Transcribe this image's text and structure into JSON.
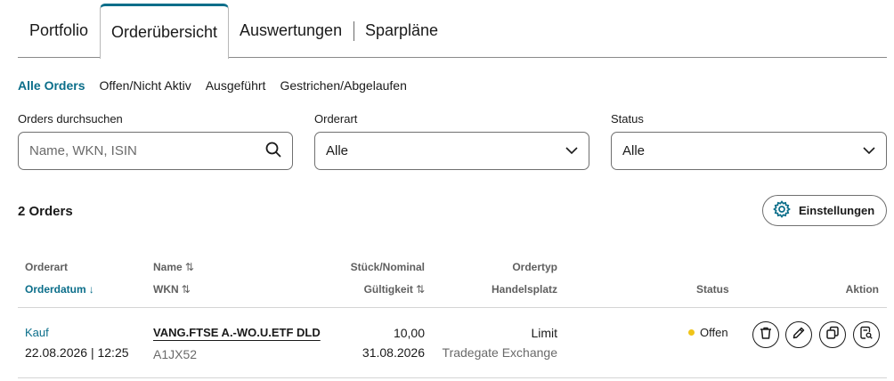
{
  "tabs": [
    {
      "label": "Portfolio"
    },
    {
      "label": "Orderübersicht"
    },
    {
      "label": "Auswertungen"
    },
    {
      "label": "Sparpläne"
    }
  ],
  "subfilters": [
    {
      "label": "Alle Orders"
    },
    {
      "label": "Offen/Nicht Aktiv"
    },
    {
      "label": "Ausgeführt"
    },
    {
      "label": "Gestrichen/Abgelaufen"
    }
  ],
  "filters": {
    "search": {
      "label": "Orders durchsuchen",
      "placeholder": "Name, WKN, ISIN",
      "value": ""
    },
    "orderart": {
      "label": "Orderart",
      "value": "Alle"
    },
    "status": {
      "label": "Status",
      "value": "Alle"
    }
  },
  "summary": {
    "count": "2 Orders",
    "settings_label": "Einstellungen"
  },
  "table": {
    "headers": {
      "orderart": "Orderart",
      "orderdatum": "Orderdatum",
      "name": "Name",
      "wkn": "WKN",
      "stueck": "Stück/Nominal",
      "gueltigkeit": "Gültigkeit",
      "ordertyp": "Ordertyp",
      "handelsplatz": "Handelsplatz",
      "status": "Status",
      "aktion": "Aktion"
    },
    "rows": [
      {
        "orderart": "Kauf",
        "datum": "22.08.2026 | 12:25",
        "name": "VANG.FTSE A.-WO.U.ETF DLD",
        "wkn": "A1JX52",
        "stueck": "10,00",
        "gueltigkeit": "31.08.2026",
        "ordertyp": "Limit",
        "handelsplatz": "Tradegate Exchange",
        "status": "Offen"
      }
    ]
  },
  "icons": {
    "search": "search-icon",
    "chevron": "chevron-down-icon",
    "settings": "gear-icon",
    "delete": "trash-icon",
    "edit": "pencil-icon",
    "copy": "copy-icon",
    "details": "document-search-icon"
  },
  "colors": {
    "accent": "#0b6e8a",
    "status_open": "#f0c419"
  }
}
